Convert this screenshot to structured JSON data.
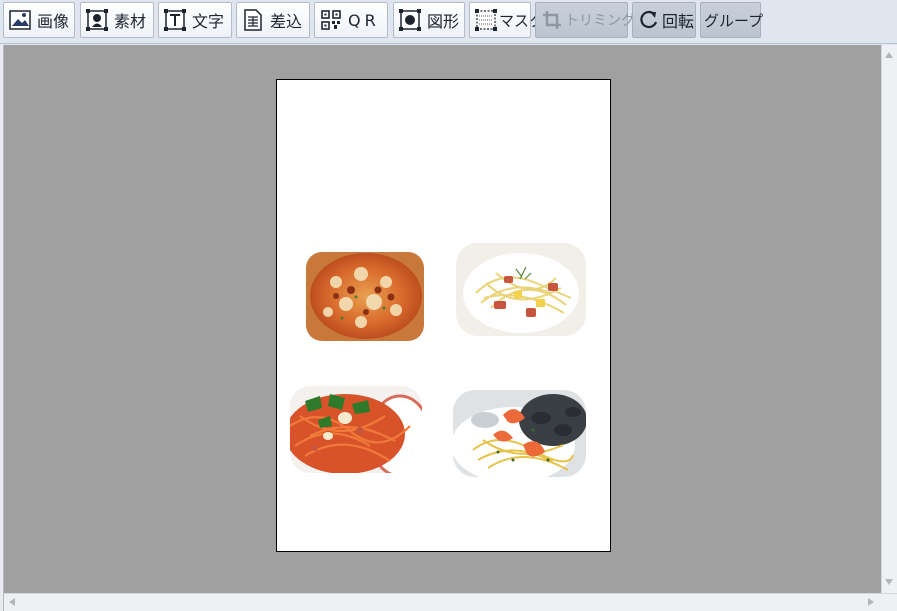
{
  "toolbar": {
    "image_label": "画像",
    "material_label": "素材",
    "text_label": "文字",
    "merge_label": "差込",
    "qr_label": "QR",
    "shape_label": "図形",
    "mask_label": "マスク",
    "trimming_label": "トリミング",
    "rotate_label": "回転",
    "group_label": "グループ"
  },
  "canvas": {
    "photos": [
      "pizza-photo",
      "bacon-pasta-photo",
      "napolitan-pasta-photo",
      "seafood-pasta-photo"
    ]
  },
  "colors": {
    "toolbar_bg": "#dfe6f0",
    "workarea_bg": "#a0a0a0",
    "page_bg": "#ffffff"
  }
}
